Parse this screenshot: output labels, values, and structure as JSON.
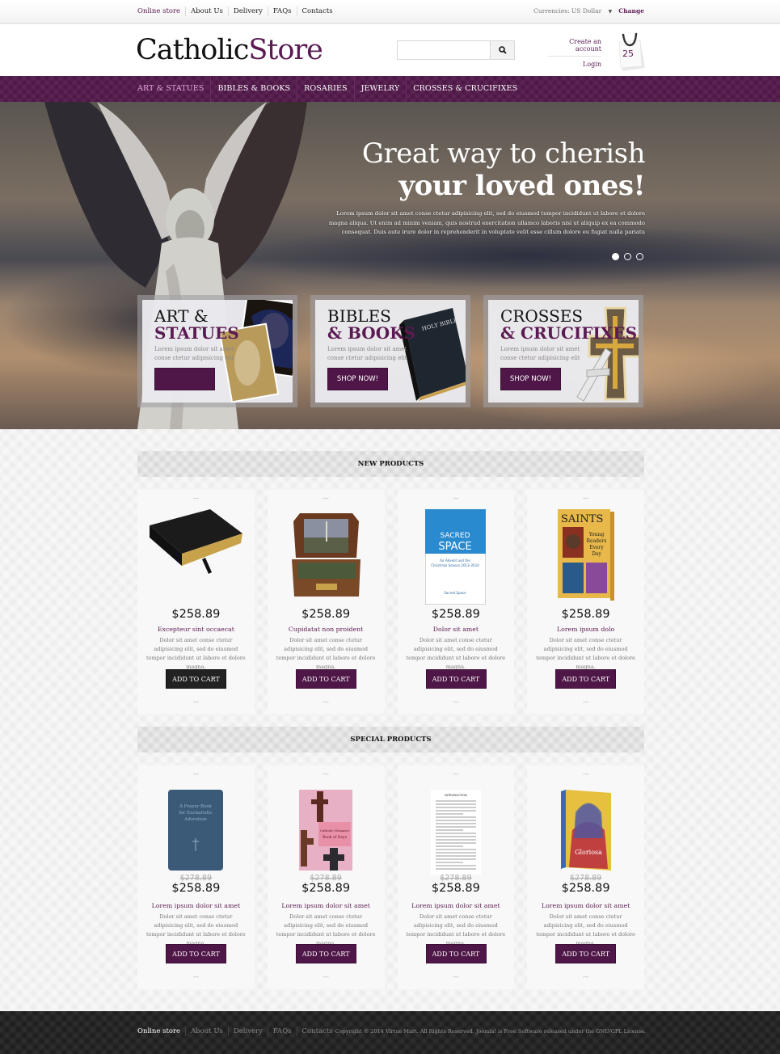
{
  "topbar": {
    "links": [
      "Online store",
      "About Us",
      "Delivery",
      "FAQs",
      "Contacts"
    ],
    "currency_label": "Currencies:",
    "currency_value": "US Dollar",
    "change_label": "Change"
  },
  "header": {
    "logo_part1": "Catholic",
    "logo_part2": "Store",
    "search_placeholder": "",
    "search_icon": "search-icon",
    "create_account": "Create an account",
    "login": "Login",
    "cart_count": "25"
  },
  "nav": {
    "items": [
      "ART & STATUES",
      "BIBLES & BOOKS",
      "ROSARIES",
      "JEWELRY",
      "CROSSES & CRUCIFIXES"
    ],
    "active_index": 0
  },
  "hero": {
    "title_line1": "Great way to cherish",
    "title_line2": "your loved ones!",
    "text": "Lorem ipsum dolor sit amet conse ctetur adipisicing elit, sed do eiusmod tempor incididunt ut labore et dolore magna aliqua. Ut enim ad minim veniam, quis nostrud exercitation ullamco laboris nisi ut aliquip ex ea commodo consequat. Duis aute irure dolor in reprehenderit in voluptate velit esse cillum dolore eu fugiat nulla pariatu",
    "slides": 3,
    "active_slide": 0,
    "banners": [
      {
        "line1": "ART &",
        "line2": "STATUES",
        "desc": "Lorem ipsum dolor sit amet conse ctetur adipisicing elit",
        "button": ""
      },
      {
        "line1": "BIBLES",
        "line2": "& BOOKS",
        "desc": "Lorem ipsum dolor sit amet conse ctetur adipisicing elit",
        "button": "SHOP NOW!"
      },
      {
        "line1": "CROSSES",
        "line2": "& CRUCIFIXES",
        "desc": "Lorem ipsum dolor sit amet conse ctetur adipisicing elit",
        "button": "SHOP NOW!"
      }
    ]
  },
  "new_products": {
    "title": "NEW PRODUCTS",
    "items": [
      {
        "price": "$258.89",
        "name": "Excepteur sint occaecat",
        "desc": "Dolor sit amet conse ctetur adipisicing elit, sed do eiusmod tempor incididunt ut labore et dolore magna.",
        "button": "ADD TO CART",
        "image": "black-bible"
      },
      {
        "price": "$258.89",
        "name": "Cupidatat non proident",
        "desc": "Dolor sit amet conse ctetur adipisicing elit, sed do eiusmod tempor incididunt ut labore et dolore magna.",
        "button": "ADD TO CART",
        "image": "rosary-box"
      },
      {
        "price": "$258.89",
        "name": "Dolor sit amet",
        "desc": "Dolor sit amet conse ctetur adipisicing elit, sed do eiusmod tempor incididunt ut labore et dolore magna.",
        "button": "ADD TO CART",
        "image": "sacred-space-book"
      },
      {
        "price": "$258.89",
        "name": "Lorem ipsum dolo",
        "desc": "Dolor sit amet conse ctetur adipisicing elit, sed do eiusmod tempor incididunt ut labore et dolore magna.",
        "button": "ADD TO CART",
        "image": "saints-book"
      }
    ]
  },
  "special_products": {
    "title": "SPECIAL PRODUCTS",
    "items": [
      {
        "old_price": "$278.89",
        "price": "$258.89",
        "name": "Lorem ipsum dolor sit amet",
        "desc": "Dolor sit amet conse ctetur adipisicing elit, sed do eiusmod tempor incididunt ut labore et dolore magna.",
        "button": "ADD TO CART",
        "image": "prayer-book"
      },
      {
        "old_price": "$278.89",
        "price": "$258.89",
        "name": "Lorem ipsum dolor sit amet",
        "desc": "Dolor sit amet conse ctetur adipisicing elit, sed do eiusmod tempor incididunt ut labore et dolore magna.",
        "button": "ADD TO CART",
        "image": "crosses-book"
      },
      {
        "old_price": "$278.89",
        "price": "$258.89",
        "name": "Lorem ipsum dolor sit amet",
        "desc": "Dolor sit amet conse ctetur adipisicing elit, sed do eiusmod tempor incididunt ut labore et dolore magna.",
        "button": "ADD TO CART",
        "image": "text-page"
      },
      {
        "old_price": "$278.89",
        "price": "$258.89",
        "name": "Lorem ipsum dolor sit amet",
        "desc": "Dolor sit amet conse ctetur adipisicing elit, sed do eiusmod tempor incididunt ut labore et dolore magna.",
        "button": "ADD TO CART",
        "image": "mary-book"
      }
    ]
  },
  "footer": {
    "links": [
      "Online store",
      "About Us",
      "Delivery",
      "FAQs",
      "Contacts"
    ],
    "copyright": "Copyright © 2014 Virtue Mart.  All Rights Reserved. Joomla! is Free Software released under the GNU/GPL License."
  },
  "colors": {
    "brand": "#4f1747",
    "accent_text": "#5b1a52",
    "nav_active": "#e8a7e0"
  }
}
